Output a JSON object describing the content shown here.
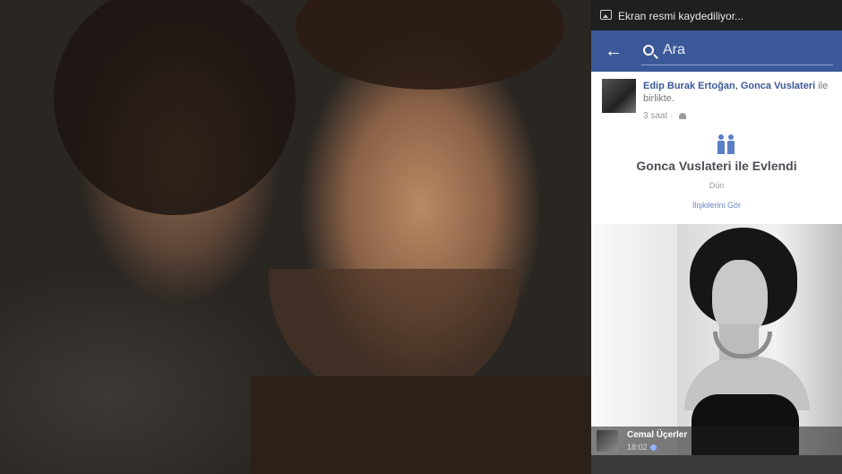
{
  "status_bar": {
    "notification": "Ekran resmi kaydediliyor..."
  },
  "search": {
    "placeholder": "Ara"
  },
  "post": {
    "author_1": "Edip Burak Ertoğan",
    "separator": ", ",
    "author_2": "Gonca Vuslateri",
    "tail": " ile birlikte.",
    "time": "3 saat · "
  },
  "life_event": {
    "title": "Gonca Vuslateri ile Evlendi",
    "date": "Dün",
    "link": "İlişkilerini Gör"
  },
  "comment": {
    "author": "Cemal Üçerler",
    "time": "18:02"
  },
  "colors": {
    "facebook_blue": "#3b5998",
    "status_bar": "#1f1f1f"
  }
}
